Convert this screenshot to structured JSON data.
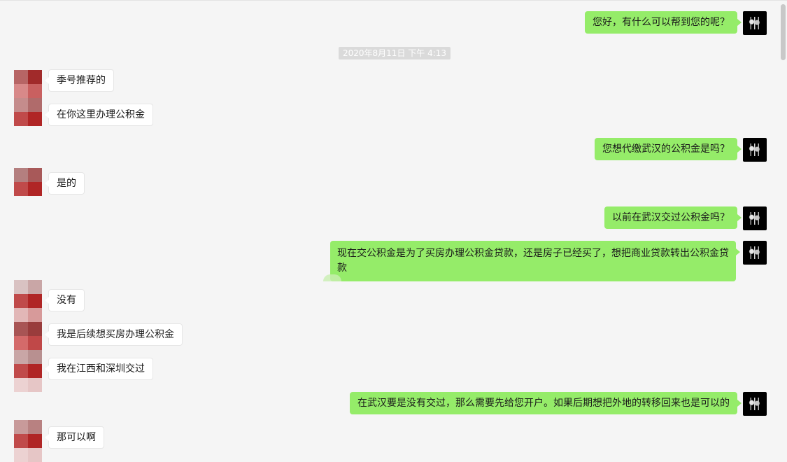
{
  "chat": {
    "timestamp": "2020年8月11日 下午 4:13",
    "messages": [
      {
        "side": "right",
        "text": "您好，有什么可以帮到您的呢？"
      },
      {
        "side": "left",
        "text": "季号推荐的"
      },
      {
        "side": "left",
        "text": "在你这里办理公积金"
      },
      {
        "side": "right",
        "text": "您想代缴武汉的公积金是吗？"
      },
      {
        "side": "left",
        "text": "是的"
      },
      {
        "side": "right",
        "text": "以前在武汉交过公积金吗？"
      },
      {
        "side": "right",
        "text": "现在交公积金是为了买房办理公积金贷款，还是房子已经买了，想把商业贷款转出公积金贷款"
      },
      {
        "side": "left",
        "text": "没有"
      },
      {
        "side": "left",
        "text": "我是后续想买房办理公积金"
      },
      {
        "side": "left",
        "text": "我在江西和深圳交过"
      },
      {
        "side": "right",
        "text": "在武汉要是没有交过，那么需要先给您开户。如果后期想把外地的转移回来也是可以的"
      },
      {
        "side": "left",
        "text": "那可以啊"
      }
    ]
  },
  "colors": {
    "background": "#f5f5f5",
    "my_bubble": "#95ec69",
    "their_bubble": "#ffffff",
    "timestamp_bg": "#dadada",
    "avatar_mosaic_dark": "#b52f2f",
    "avatar_mosaic_light": "#e6c6c6"
  },
  "icons": {
    "my_avatar": "dark-avatar-icon",
    "their_avatar": "pixelated-avatar-icon"
  }
}
